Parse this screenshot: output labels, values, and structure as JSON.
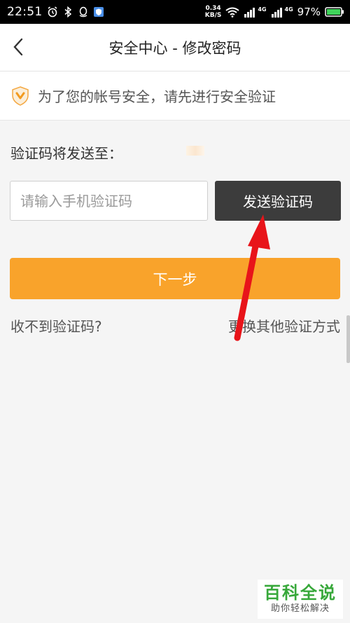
{
  "status_bar": {
    "time": "22:51",
    "net_speed_value": "0.34",
    "net_speed_unit": "KB/S",
    "battery": "97%",
    "network_label_1": "4G",
    "network_label_2": "4G"
  },
  "header": {
    "title": "安全中心 - 修改密码"
  },
  "notice": {
    "text": "为了您的帐号安全，请先进行安全验证"
  },
  "verify": {
    "send_label": "验证码将发送至：",
    "input_placeholder": "请输入手机验证码",
    "input_value": "",
    "send_button": "发送验证码"
  },
  "actions": {
    "next_button": "下一步",
    "no_code_link": "收不到验证码?",
    "other_method_link": "更换其他验证方式"
  },
  "watermark": {
    "main": "百科全说",
    "sub": "助你轻松解决"
  },
  "colors": {
    "accent": "#f9a32b",
    "send_button_bg": "#3c3c3c",
    "arrow": "#e8141a",
    "watermark_green": "#37a83a"
  }
}
